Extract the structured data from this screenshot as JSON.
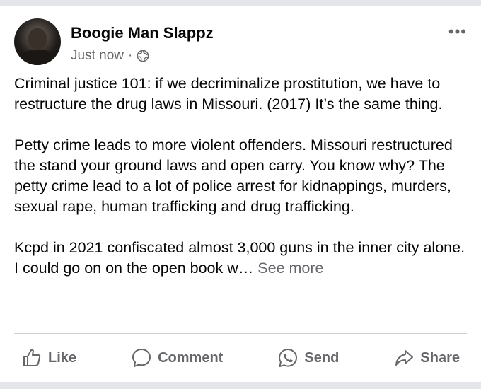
{
  "post": {
    "author": "Boogie Man Slappz",
    "timestamp": "Just now",
    "separator": "·",
    "privacy_icon": "globe-icon",
    "more_icon": "more-options-icon",
    "paragraphs": [
      "Criminal justice 101: if we decriminalize prostitution, we have to restructure the drug laws in Missouri. (2017) It’s the same thing.",
      "Petty crime leads to more violent offenders. Missouri restructured the stand your ground laws and open carry. You know why? The petty crime lead to a lot of police arrest for kidnappings, murders, sexual rape, human trafficking and drug trafficking."
    ],
    "truncated_paragraph": "Kcpd in 2021 confiscated almost 3,000 guns in the inner city alone. I could go on on the open book w…",
    "see_more": "See more"
  },
  "actions": {
    "like": "Like",
    "comment": "Comment",
    "send": "Send",
    "share": "Share"
  },
  "colors": {
    "text_primary": "#050505",
    "text_secondary": "#65676b",
    "divider": "#ced0d4",
    "background": "#e4e6ea"
  }
}
